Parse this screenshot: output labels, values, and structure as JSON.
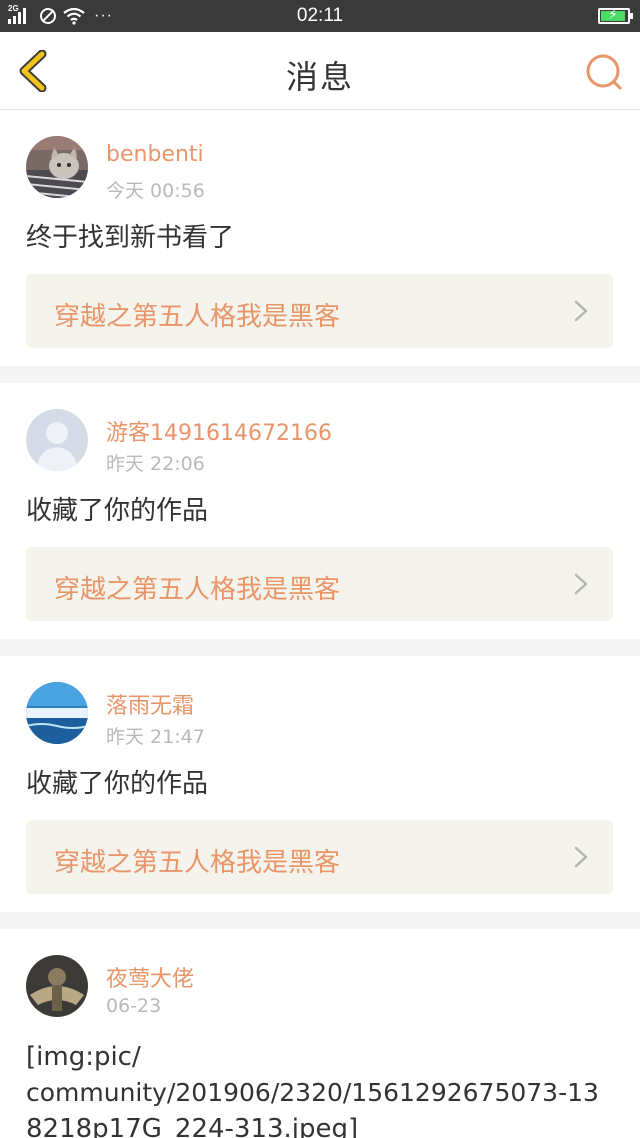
{
  "status_bar": {
    "network": "2G",
    "time": "02:11",
    "dots": "···"
  },
  "header": {
    "title": "消息"
  },
  "messages": [
    {
      "username": "benbenti",
      "time": "今天 00:56",
      "text": "终于找到新书看了",
      "book_title": "穿越之第五人格我是黑客",
      "avatar": "cat-photo"
    },
    {
      "username": "游客1491614672166",
      "time": "昨天 22:06",
      "text": "收藏了你的作品",
      "book_title": "穿越之第五人格我是黑客",
      "avatar": "default-user"
    },
    {
      "username": "落雨无霜",
      "time": "昨天 21:47",
      "text": "收藏了你的作品",
      "book_title": "穿越之第五人格我是黑客",
      "avatar": "sky-photo"
    },
    {
      "username": "夜莺大佬",
      "time": "06-23",
      "text_lines": [
        "[img:pic/",
        "community/201906/2320/1561292675073-13",
        "8218p17G_224-313.jpeg]"
      ],
      "avatar": "character-photo"
    }
  ],
  "colors": {
    "accent": "#e8956a",
    "back_icon": "#f0c419",
    "status_bar": "#3a3a3a",
    "book_bg": "#f4f3ec",
    "battery": "#4cd964"
  }
}
